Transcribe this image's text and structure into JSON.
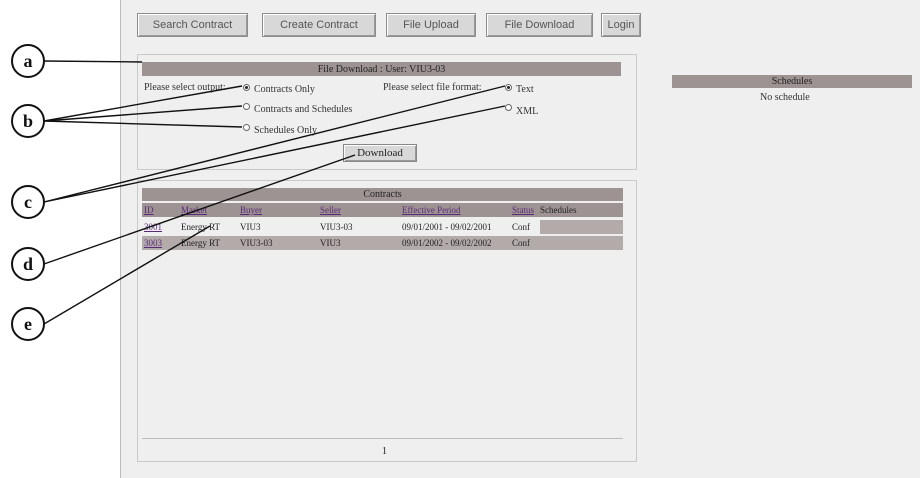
{
  "nav": {
    "search": "Search Contract",
    "create": "Create Contract",
    "upload": "File Upload",
    "download": "File Download",
    "login": "Login"
  },
  "download_panel": {
    "title": "File Download : User: VIU3-03",
    "output_label": "Please select output:",
    "output_options": [
      "Contracts Only",
      "Contracts and Schedules",
      "Schedules Only"
    ],
    "format_label": "Please select file format:",
    "format_options": [
      "Text",
      "XML"
    ],
    "download_button": "Download"
  },
  "contracts": {
    "title": "Contracts",
    "columns": [
      "ID",
      "Market",
      "Buyer",
      "Seller",
      "Effective Period",
      "Status",
      "Schedules"
    ],
    "rows": [
      [
        "3001",
        "Energy RT",
        "VIU3",
        "VIU3-03",
        "09/01/2001 - 09/02/2001",
        "Conf",
        ""
      ],
      [
        "3003",
        "Energy RT",
        "VIU3-03",
        "VIU3",
        "09/01/2002 - 09/02/2002",
        "Conf",
        ""
      ]
    ],
    "footer": "1"
  },
  "schedules": {
    "title": "Schedules",
    "empty": "No schedule"
  },
  "callouts": [
    "a",
    "b",
    "c",
    "d",
    "e"
  ]
}
